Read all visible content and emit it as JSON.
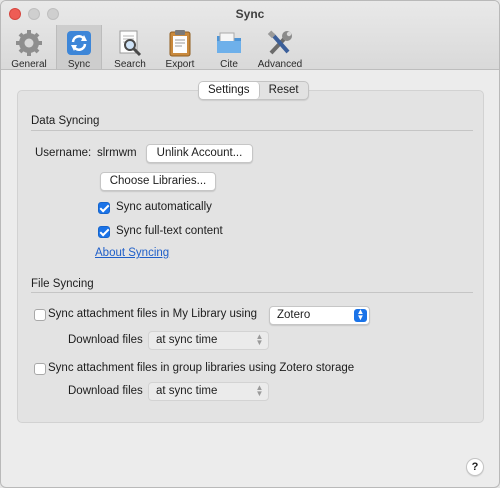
{
  "window": {
    "title": "Sync"
  },
  "toolbar": {
    "items": [
      {
        "label": "General",
        "icon": "gear-icon"
      },
      {
        "label": "Sync",
        "icon": "sync-icon",
        "active": true
      },
      {
        "label": "Search",
        "icon": "search-icon"
      },
      {
        "label": "Export",
        "icon": "clipboard-icon"
      },
      {
        "label": "Cite",
        "icon": "folder-icon"
      },
      {
        "label": "Advanced",
        "icon": "tools-icon"
      }
    ]
  },
  "tabs": {
    "settings": "Settings",
    "reset": "Reset"
  },
  "data_syncing": {
    "title": "Data Syncing",
    "username_label": "Username:",
    "username_value": "slrmwm",
    "unlink_button": "Unlink Account...",
    "choose_libraries_button": "Choose Libraries...",
    "sync_automatically": "Sync automatically",
    "sync_fulltext": "Sync full-text content",
    "about_link": "About Syncing"
  },
  "file_syncing": {
    "title": "File Syncing",
    "my_library_label": "Sync attachment files in My Library using",
    "my_library_method": "Zotero",
    "download_label_1": "Download files",
    "download_value_1": "at sync time",
    "group_label": "Sync attachment files in group libraries using Zotero storage",
    "download_label_2": "Download files",
    "download_value_2": "at sync time"
  },
  "help": {
    "label": "?"
  },
  "colors": {
    "accent": "#1a73e8",
    "link": "#1f5fc9",
    "close": "#ee5c55"
  }
}
